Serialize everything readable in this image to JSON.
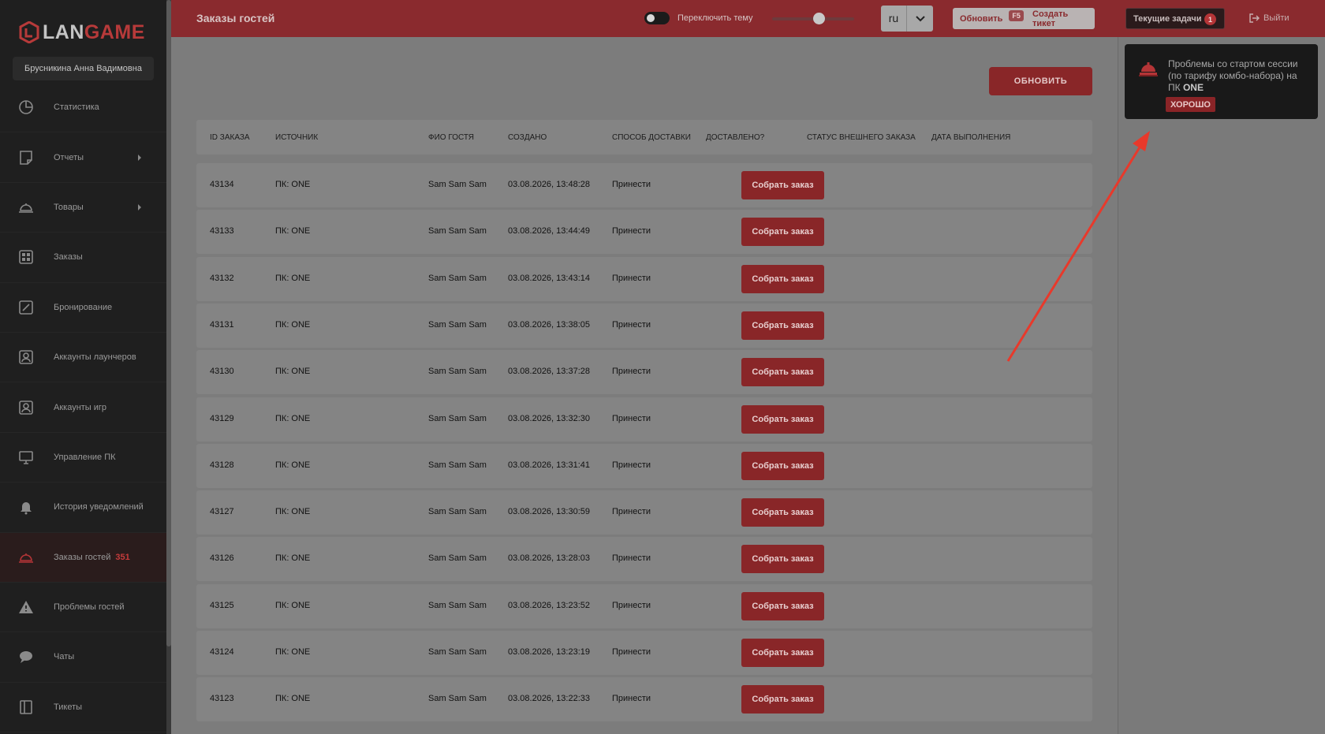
{
  "app": {
    "logo_prefix": "LAN",
    "logo_suffix": "GAME",
    "user_name": "Брусникина Анна Вадимовна"
  },
  "sidebar": {
    "items": [
      {
        "label": "Статистика",
        "icon": "pie-chart-icon"
      },
      {
        "label": "Отчеты",
        "icon": "report-icon",
        "has_submenu": true
      },
      {
        "label": "Товары",
        "icon": "cloche-icon",
        "has_submenu": true
      },
      {
        "label": "Заказы",
        "icon": "grid-icon"
      },
      {
        "label": "Бронирование",
        "icon": "edit-icon"
      },
      {
        "label": "Аккаунты лаунчеров",
        "icon": "account-icon"
      },
      {
        "label": "Аккаунты игр",
        "icon": "account-icon"
      },
      {
        "label": "Управление ПК",
        "icon": "monitor-icon"
      },
      {
        "label": "История уведомлений",
        "icon": "bell-icon"
      },
      {
        "label": "Заказы гостей",
        "icon": "cloche-icon",
        "badge": "351",
        "active": true
      },
      {
        "label": "Проблемы гостей",
        "icon": "warning-icon"
      },
      {
        "label": "Чаты",
        "icon": "chat-icon"
      },
      {
        "label": "Тикеты",
        "icon": "ticket-icon"
      }
    ]
  },
  "header": {
    "title": "Заказы гостей",
    "theme_label": "Переключить тему",
    "lang_value": "ru",
    "refresh_label": "Обновить",
    "refresh_key": "F5",
    "ticket_label": "Создать тикет",
    "tasks_label": "Текущие задачи",
    "tasks_count": "1",
    "logout_label": "Выйти"
  },
  "main": {
    "refresh_button": "ОБНОВИТЬ",
    "columns": [
      "ID ЗАКАЗА",
      "ИСТОЧНИК",
      "ФИО ГОСТЯ",
      "СОЗДАНО",
      "СПОСОБ ДОСТАВКИ",
      "ДОСТАВЛЕНО?",
      "СТАТУС ВНЕШНЕГО ЗАКАЗА",
      "ДАТА ВЫПОЛНЕНИЯ"
    ],
    "action_label": "Собрать заказ",
    "rows": [
      {
        "id": "43134",
        "source": "ПК: ONE",
        "guest": "Sam Sam Sam",
        "created": "03.08.2026, 13:48:28",
        "delivery": "Принести"
      },
      {
        "id": "43133",
        "source": "ПК: ONE",
        "guest": "Sam Sam Sam",
        "created": "03.08.2026, 13:44:49",
        "delivery": "Принести"
      },
      {
        "id": "43132",
        "source": "ПК: ONE",
        "guest": "Sam Sam Sam",
        "created": "03.08.2026, 13:43:14",
        "delivery": "Принести"
      },
      {
        "id": "43131",
        "source": "ПК: ONE",
        "guest": "Sam Sam Sam",
        "created": "03.08.2026, 13:38:05",
        "delivery": "Принести"
      },
      {
        "id": "43130",
        "source": "ПК: ONE",
        "guest": "Sam Sam Sam",
        "created": "03.08.2026, 13:37:28",
        "delivery": "Принести"
      },
      {
        "id": "43129",
        "source": "ПК: ONE",
        "guest": "Sam Sam Sam",
        "created": "03.08.2026, 13:32:30",
        "delivery": "Принести"
      },
      {
        "id": "43128",
        "source": "ПК: ONE",
        "guest": "Sam Sam Sam",
        "created": "03.08.2026, 13:31:41",
        "delivery": "Принести"
      },
      {
        "id": "43127",
        "source": "ПК: ONE",
        "guest": "Sam Sam Sam",
        "created": "03.08.2026, 13:30:59",
        "delivery": "Принести"
      },
      {
        "id": "43126",
        "source": "ПК: ONE",
        "guest": "Sam Sam Sam",
        "created": "03.08.2026, 13:28:03",
        "delivery": "Принести"
      },
      {
        "id": "43125",
        "source": "ПК: ONE",
        "guest": "Sam Sam Sam",
        "created": "03.08.2026, 13:23:52",
        "delivery": "Принести"
      },
      {
        "id": "43124",
        "source": "ПК: ONE",
        "guest": "Sam Sam Sam",
        "created": "03.08.2026, 13:23:19",
        "delivery": "Принести"
      },
      {
        "id": "43123",
        "source": "ПК: ONE",
        "guest": "Sam Sam Sam",
        "created": "03.08.2026, 13:22:33",
        "delivery": "Принести"
      }
    ]
  },
  "toast": {
    "text_prefix": "Проблемы со стартом сессии (по тарифу комбо-набора) на ПК",
    "text_bold": "ONE",
    "ok_label": "ХОРОШО"
  },
  "colors": {
    "accent": "#892628",
    "header_bg": "#8a2a2e",
    "sidebar_bg": "#1f1f1f",
    "annotation_arrow": "#e8392b"
  }
}
